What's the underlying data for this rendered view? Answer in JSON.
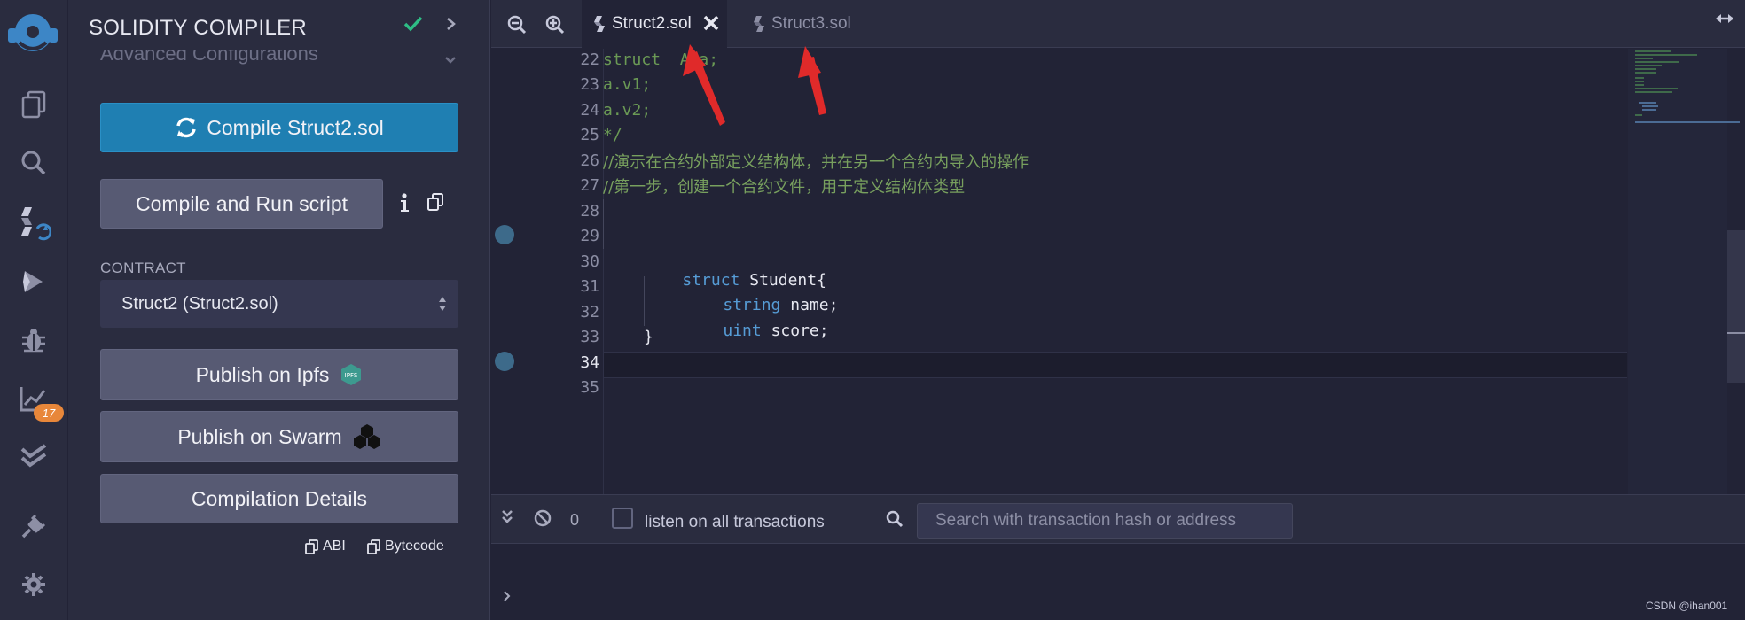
{
  "rail": {
    "icons": [
      "remix-logo",
      "file-explorer-icon",
      "search-icon",
      "solidity-compiler-icon",
      "deploy-run-icon",
      "debugger-icon",
      "analysis-icon",
      "test-icon",
      "plugin-manager-icon",
      "settings-icon"
    ],
    "badge_count": "17"
  },
  "panel": {
    "title": "SOLIDITY COMPILER",
    "advanced_label": "Advanced Configurations",
    "compile_button": "Compile Struct2.sol",
    "run_script_button": "Compile and Run script",
    "contract_label": "CONTRACT",
    "contract_selected": "Struct2 (Struct2.sol)",
    "publish_ipfs": "Publish on Ipfs",
    "ipfs_logo_text": "IPFS",
    "publish_swarm": "Publish on Swarm",
    "details_button": "Compilation Details",
    "abi_label": "ABI",
    "bytecode_label": "Bytecode",
    "colors": {
      "primary": "#1f7fb2",
      "success": "#2ebd85"
    }
  },
  "tabs": [
    {
      "label": "Struct2.sol",
      "active": true
    },
    {
      "label": "Struct3.sol",
      "active": false
    }
  ],
  "editor": {
    "lines": [
      {
        "n": "22",
        "text": "struct  A a;"
      },
      {
        "n": "23",
        "text": "a.v1;"
      },
      {
        "n": "24",
        "text": "a.v2;"
      },
      {
        "n": "25",
        "text": "*/"
      },
      {
        "n": "26",
        "text": "//演示在合约外部定义结构体，并在另一个合约内导入的操作"
      },
      {
        "n": "27",
        "text": "//第一步，创建一个合约文件，用于定义结构体类型"
      },
      {
        "n": "28",
        "text": ""
      },
      {
        "n": "29",
        "text": ""
      },
      {
        "n": "30",
        "kw": "struct",
        "rest": " Student{"
      },
      {
        "n": "31",
        "kw": "string",
        "rest": " name;"
      },
      {
        "n": "32",
        "kw": "uint",
        "rest": " score;"
      },
      {
        "n": "33",
        "text": "}"
      },
      {
        "n": "34",
        "text": ""
      },
      {
        "n": "35",
        "text": ""
      }
    ]
  },
  "terminal": {
    "pending_count": "0",
    "listen_label": "listen on all transactions",
    "search_placeholder": "Search with transaction hash or address"
  },
  "watermark": "CSDN @ihan001"
}
